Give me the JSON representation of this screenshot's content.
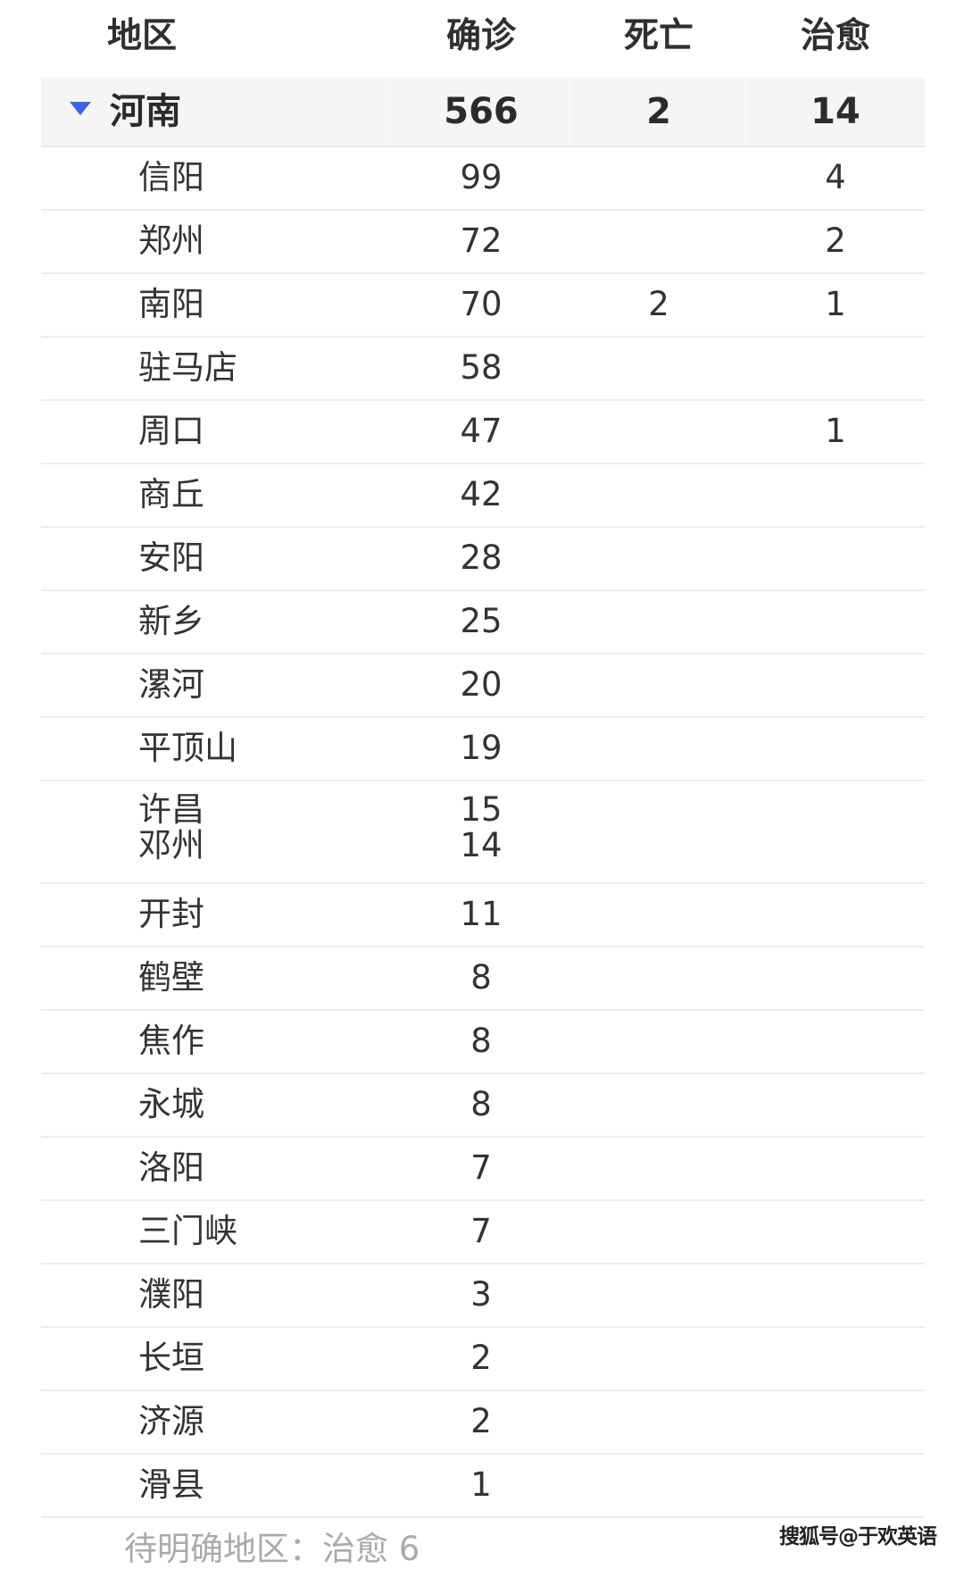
{
  "header": {
    "region": "地区",
    "confirmed": "确诊",
    "deaths": "死亡",
    "recovered": "治愈"
  },
  "province": {
    "expand_icon": "triangle-down-icon",
    "accent_color": "#3a64dd",
    "name": "河南",
    "confirmed": "566",
    "deaths": "2",
    "recovered": "14"
  },
  "cities": [
    {
      "name": "信阳",
      "confirmed": "99",
      "deaths": "",
      "recovered": "4"
    },
    {
      "name": "郑州",
      "confirmed": "72",
      "deaths": "",
      "recovered": "2"
    },
    {
      "name": "南阳",
      "confirmed": "70",
      "deaths": "2",
      "recovered": "1"
    },
    {
      "name": "驻马店",
      "confirmed": "58",
      "deaths": "",
      "recovered": ""
    },
    {
      "name": "周口",
      "confirmed": "47",
      "deaths": "",
      "recovered": "1"
    },
    {
      "name": "商丘",
      "confirmed": "42",
      "deaths": "",
      "recovered": ""
    },
    {
      "name": "安阳",
      "confirmed": "28",
      "deaths": "",
      "recovered": ""
    },
    {
      "name": "新乡",
      "confirmed": "25",
      "deaths": "",
      "recovered": ""
    },
    {
      "name": "漯河",
      "confirmed": "20",
      "deaths": "",
      "recovered": ""
    },
    {
      "name": "平顶山",
      "confirmed": "19",
      "deaths": "",
      "recovered": ""
    },
    {
      "name": "许昌",
      "confirmed": "15",
      "deaths": "",
      "recovered": "",
      "second_name": "邓州",
      "second_confirmed": "14"
    },
    {
      "name": "开封",
      "confirmed": "11",
      "deaths": "",
      "recovered": ""
    },
    {
      "name": "鹤壁",
      "confirmed": "8",
      "deaths": "",
      "recovered": ""
    },
    {
      "name": "焦作",
      "confirmed": "8",
      "deaths": "",
      "recovered": ""
    },
    {
      "name": "永城",
      "confirmed": "8",
      "deaths": "",
      "recovered": ""
    },
    {
      "name": "洛阳",
      "confirmed": "7",
      "deaths": "",
      "recovered": ""
    },
    {
      "name": "三门峡",
      "confirmed": "7",
      "deaths": "",
      "recovered": ""
    },
    {
      "name": "濮阳",
      "confirmed": "3",
      "deaths": "",
      "recovered": ""
    },
    {
      "name": "长垣",
      "confirmed": "2",
      "deaths": "",
      "recovered": ""
    },
    {
      "name": "济源",
      "confirmed": "2",
      "deaths": "",
      "recovered": ""
    },
    {
      "name": "滑县",
      "confirmed": "1",
      "deaths": "",
      "recovered": ""
    }
  ],
  "footer": {
    "note": "待明确地区：治愈 6"
  },
  "watermark": "搜狐号@于欢英语"
}
